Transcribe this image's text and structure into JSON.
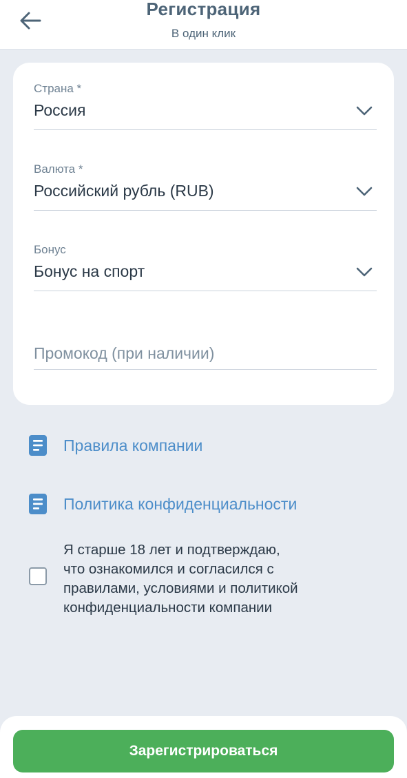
{
  "header": {
    "title": "Регистрация",
    "subtitle": "В один клик",
    "back_icon": "arrow-left-icon"
  },
  "form": {
    "country": {
      "label": "Страна *",
      "value": "Россия"
    },
    "currency": {
      "label": "Валюта *",
      "value": "Российский рубль (RUB)"
    },
    "bonus": {
      "label": "Бонус",
      "value": "Бонус на спорт"
    },
    "promo": {
      "placeholder": "Промокод (при наличии)",
      "value": ""
    }
  },
  "links": {
    "rules": "Правила компании",
    "privacy": "Политика конфиденциальности"
  },
  "consent": {
    "checked": false,
    "line1": "Я старше 18 лет и подтверждаю,",
    "line2": "что ознакомился и согласился с",
    "line3": "правилами, условиями и политикой",
    "line4": "конфиденциальности компании"
  },
  "submit_label": "Зарегистрироваться",
  "colors": {
    "accent_green": "#4caf5a",
    "link_blue": "#4c8dc9",
    "header_text": "#4d6477",
    "background": "#e8ecf2"
  }
}
